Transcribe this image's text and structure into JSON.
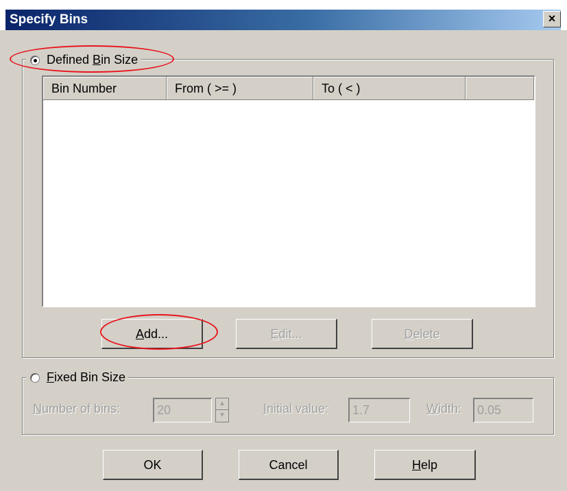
{
  "window": {
    "title": "Specify Bins",
    "close_glyph": "×"
  },
  "defined": {
    "label_pre": "Defined ",
    "label_mnemonic": "B",
    "label_post": "in Size",
    "selected": true,
    "columns": [
      "Bin Number",
      "From ( >= )",
      "To ( < )"
    ],
    "rows": [],
    "buttons": {
      "add": {
        "mnemonic": "A",
        "rest": "dd...",
        "enabled": true
      },
      "edit": {
        "mnemonic": "E",
        "rest": "dit...",
        "enabled": false
      },
      "delete": {
        "mnemonic": "D",
        "rest": "elete",
        "enabled": false
      }
    }
  },
  "fixed": {
    "label_mnemonic": "F",
    "label_post": "ixed Bin Size",
    "selected": false,
    "number_of_bins": {
      "mnemonic": "N",
      "rest": "umber of bins:",
      "value": "20"
    },
    "initial_value": {
      "mnemonic": "I",
      "rest": "nitial value:",
      "value": "1.7"
    },
    "width": {
      "mnemonic": "W",
      "rest": "idth:",
      "value": "0.05"
    }
  },
  "footer": {
    "ok": "OK",
    "cancel": "Cancel",
    "help": {
      "mnemonic": "H",
      "rest": "elp"
    }
  },
  "annotations": {
    "highlight_color": "#e8141c"
  }
}
